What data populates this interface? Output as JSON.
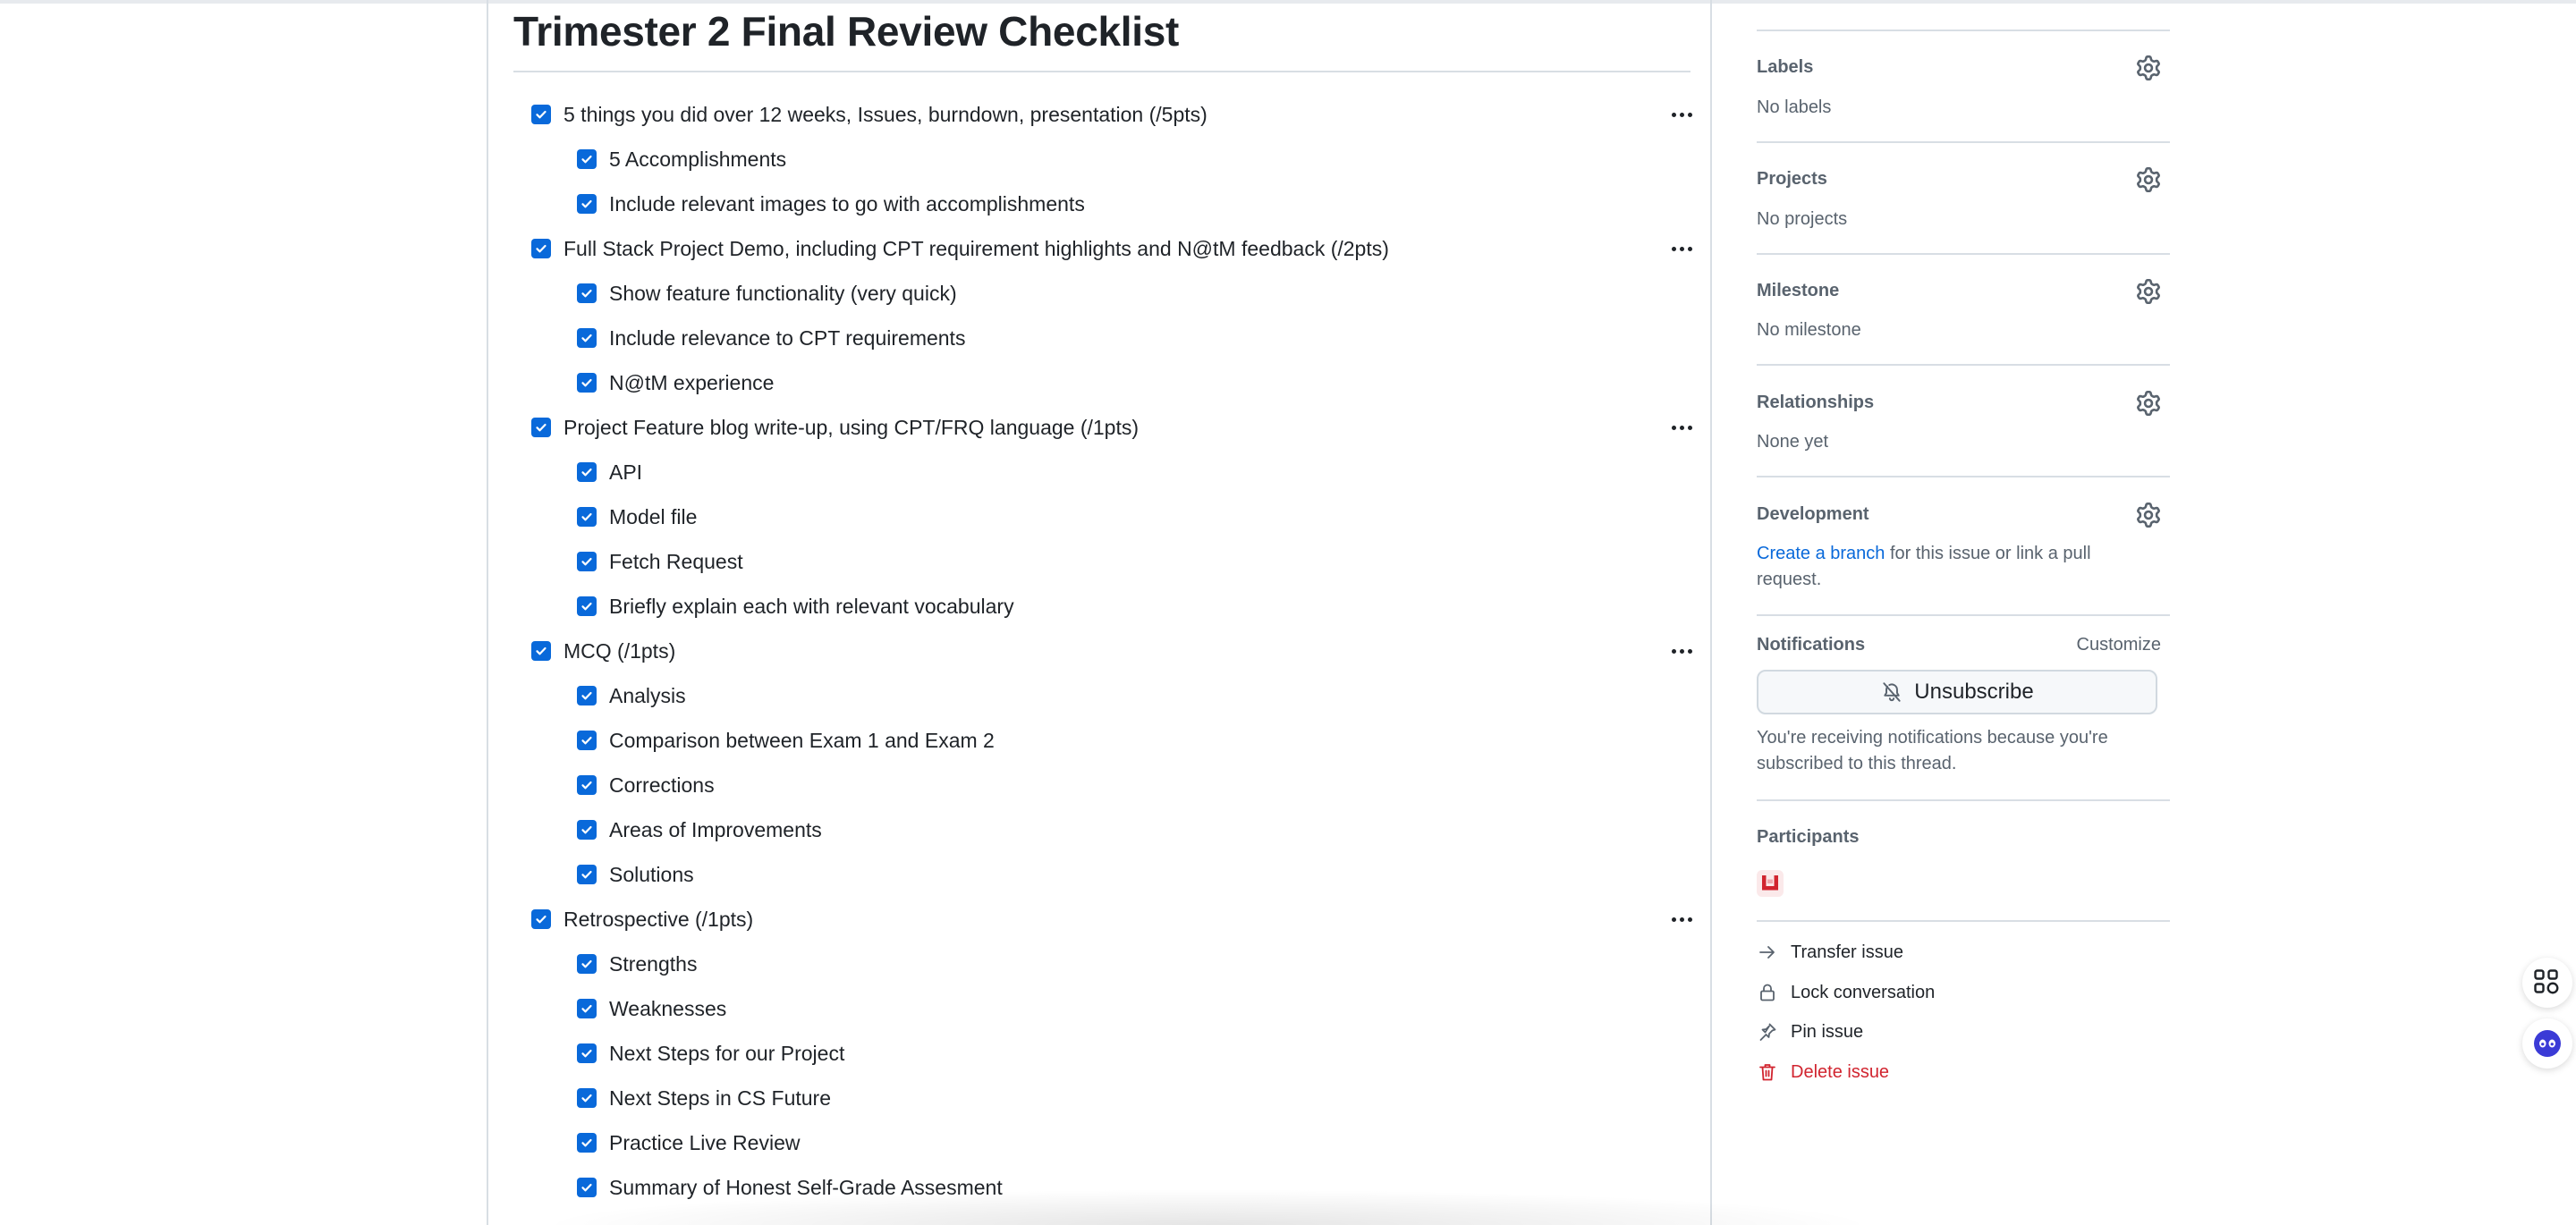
{
  "issue": {
    "title": "Trimester 2 Final Review Checklist"
  },
  "checklist": [
    {
      "text": "5 things you did over 12 weeks, Issues, burndown, presentation (/5pts)",
      "level": 0,
      "checked": true
    },
    {
      "text": "5 Accomplishments",
      "level": 1,
      "checked": true
    },
    {
      "text": "Include relevant images to go with accomplishments",
      "level": 1,
      "checked": true
    },
    {
      "text": "Full Stack Project Demo, including CPT requirement highlights and N@tM feedback (/2pts)",
      "level": 0,
      "checked": true
    },
    {
      "text": "Show feature functionality (very quick)",
      "level": 1,
      "checked": true
    },
    {
      "text": "Include relevance to CPT requirements",
      "level": 1,
      "checked": true
    },
    {
      "text": "N@tM experience",
      "level": 1,
      "checked": true
    },
    {
      "text": "Project Feature blog write-up, using CPT/FRQ language (/1pts)",
      "level": 0,
      "checked": true
    },
    {
      "text": "API",
      "level": 1,
      "checked": true
    },
    {
      "text": "Model file",
      "level": 1,
      "checked": true
    },
    {
      "text": "Fetch Request",
      "level": 1,
      "checked": true
    },
    {
      "text": "Briefly explain each with relevant vocabulary",
      "level": 1,
      "checked": true
    },
    {
      "text": "MCQ (/1pts)",
      "level": 0,
      "checked": true
    },
    {
      "text": "Analysis",
      "level": 1,
      "checked": true
    },
    {
      "text": "Comparison between Exam 1 and Exam 2",
      "level": 1,
      "checked": true
    },
    {
      "text": "Corrections",
      "level": 1,
      "checked": true
    },
    {
      "text": "Areas of Improvements",
      "level": 1,
      "checked": true
    },
    {
      "text": "Solutions",
      "level": 1,
      "checked": true
    },
    {
      "text": "Retrospective (/1pts)",
      "level": 0,
      "checked": true
    },
    {
      "text": "Strengths",
      "level": 1,
      "checked": true
    },
    {
      "text": "Weaknesses",
      "level": 1,
      "checked": true
    },
    {
      "text": "Next Steps for our Project",
      "level": 1,
      "checked": true
    },
    {
      "text": "Next Steps in CS Future",
      "level": 1,
      "checked": true
    },
    {
      "text": "Practice Live Review",
      "level": 1,
      "checked": true
    },
    {
      "text": "Summary of Honest Self-Grade Assesment",
      "level": 1,
      "checked": true
    }
  ],
  "sidebar": {
    "labels": {
      "heading": "Labels",
      "value": "No labels"
    },
    "projects": {
      "heading": "Projects",
      "value": "No projects"
    },
    "milestone": {
      "heading": "Milestone",
      "value": "No milestone"
    },
    "relationships": {
      "heading": "Relationships",
      "value": "None yet"
    },
    "development": {
      "heading": "Development",
      "link": "Create a branch",
      "text_1": " for this issue or link a pull",
      "text_2": "request."
    },
    "notifications": {
      "heading": "Notifications",
      "customize": "Customize",
      "button": "Unsubscribe",
      "note_1": "You're receiving notifications because you're",
      "note_2": "subscribed to this thread."
    },
    "participants": {
      "heading": "Participants"
    },
    "actions": [
      {
        "label": "Transfer issue",
        "icon": "arrow-right-icon"
      },
      {
        "label": "Lock conversation",
        "icon": "lock-icon"
      },
      {
        "label": "Pin issue",
        "icon": "pin-icon"
      },
      {
        "label": "Delete issue",
        "icon": "trash-icon"
      }
    ]
  },
  "colors": {
    "accent": "#0969da",
    "danger": "#d1242f",
    "muted": "#59636e",
    "border": "#d8dee4"
  }
}
